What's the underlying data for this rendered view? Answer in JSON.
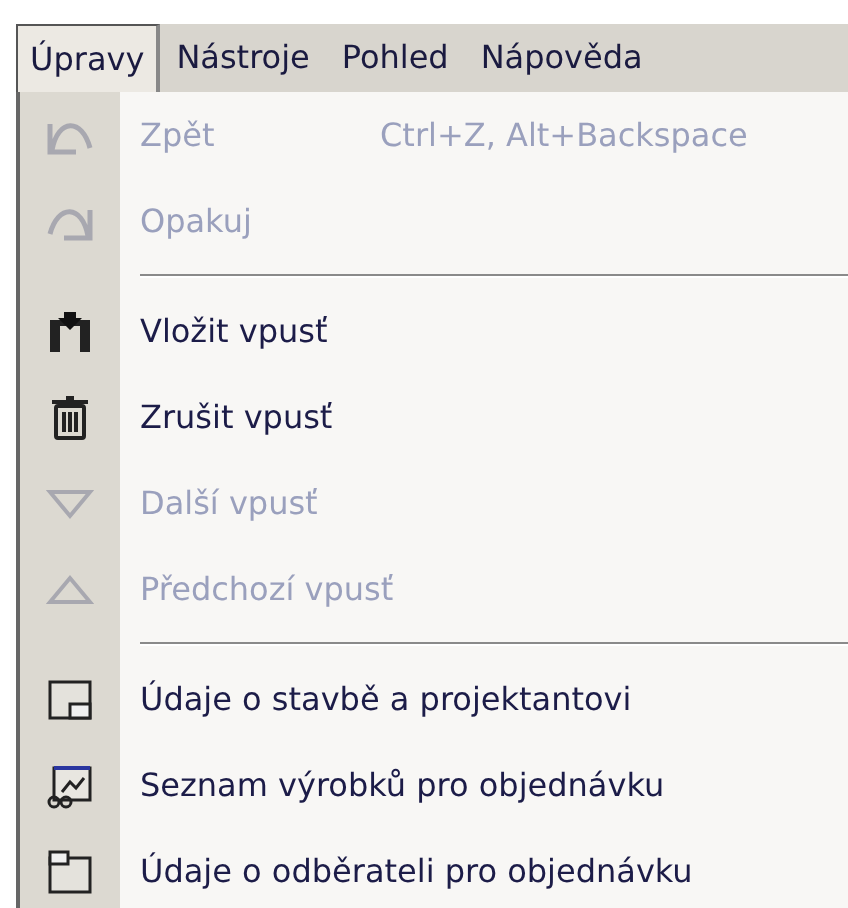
{
  "menu_bar": [
    {
      "label": "Úpravy",
      "selected": true
    },
    {
      "label": "Nástroje",
      "selected": false
    },
    {
      "label": "Pohled",
      "selected": false
    },
    {
      "label": "Nápověda",
      "selected": false
    }
  ],
  "menu": [
    {
      "kind": "item",
      "label": "Zpět",
      "shortcut": "Ctrl+Z, Alt+Backspace",
      "disabled": true
    },
    {
      "kind": "item",
      "label": "Opakuj",
      "disabled": true
    },
    {
      "kind": "separator"
    },
    {
      "kind": "item",
      "label": "Vložit vpusť",
      "disabled": false
    },
    {
      "kind": "item",
      "label": "Zrušit vpusť",
      "disabled": false
    },
    {
      "kind": "item",
      "label": "Další vpusť",
      "disabled": true
    },
    {
      "kind": "item",
      "label": "Předchozí vpusť",
      "disabled": true
    },
    {
      "kind": "separator"
    },
    {
      "kind": "item",
      "label": "Údaje o stavbě a projektantovi",
      "disabled": false
    },
    {
      "kind": "item",
      "label": "Seznam výrobků pro objednávku",
      "disabled": false
    },
    {
      "kind": "item",
      "label": "Údaje o odběrateli pro objednávku",
      "disabled": false
    }
  ]
}
